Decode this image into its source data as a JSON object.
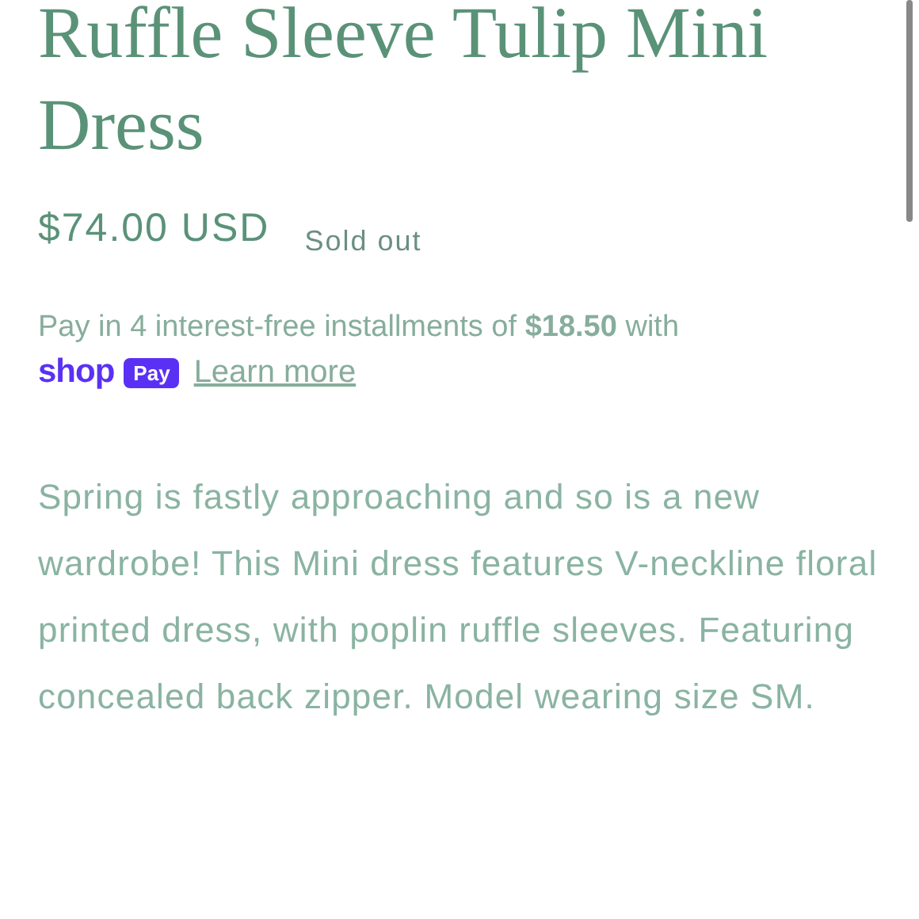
{
  "product": {
    "title": "Ruffle Sleeve Tulip Mini Dress",
    "price": "$74.00 USD",
    "badge": "Sold out"
  },
  "installments": {
    "text": "Pay in 4 interest-free installments of **$18.50** with",
    "logo_word": "shop",
    "logo_badge": "Pay",
    "link": "Learn more"
  },
  "description": "Spring is fastly approaching and so is a new wardrobe! This Mini dress features V-neckline floral printed dress, with poplin ruffle sleeves. Featuring concealed back zipper. Model wearing size SM."
}
